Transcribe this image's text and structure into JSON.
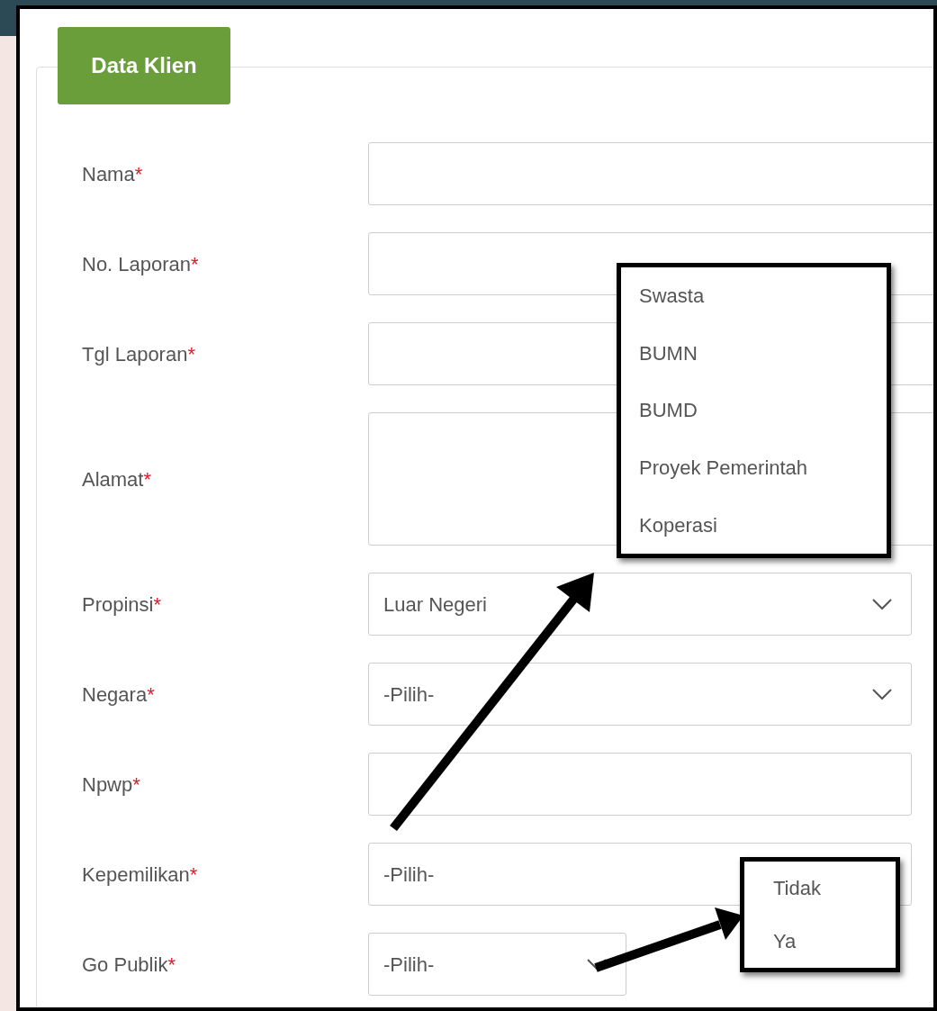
{
  "panel": {
    "legend": "Data Klien"
  },
  "fields": [
    {
      "label": "Nama",
      "required_mark": "*",
      "kind": "text"
    },
    {
      "label": "No. Laporan",
      "required_mark": "*",
      "kind": "text"
    },
    {
      "label": "Tgl Laporan",
      "required_mark": "*",
      "kind": "text"
    },
    {
      "label": "Alamat",
      "required_mark": "*",
      "kind": "textarea"
    },
    {
      "label": "Propinsi",
      "required_mark": "*",
      "kind": "select",
      "value": "Luar Negeri",
      "caret": true
    },
    {
      "label": "Negara",
      "required_mark": "*",
      "kind": "select",
      "value": "-Pilih-",
      "caret": true
    },
    {
      "label": "Npwp",
      "required_mark": "*",
      "kind": "text"
    },
    {
      "label": "Kepemilikan",
      "required_mark": "*",
      "kind": "select",
      "value": "-Pilih-"
    },
    {
      "label": "Go Publik",
      "required_mark": "*",
      "kind": "select",
      "value": "-Pilih-",
      "caret": true
    }
  ],
  "callouts": [
    {
      "options": [
        "Swasta",
        "BUMN",
        "BUMD",
        "Proyek Pemerintah",
        "Koperasi"
      ]
    },
    {
      "options": [
        "Tidak",
        "Ya"
      ]
    }
  ]
}
